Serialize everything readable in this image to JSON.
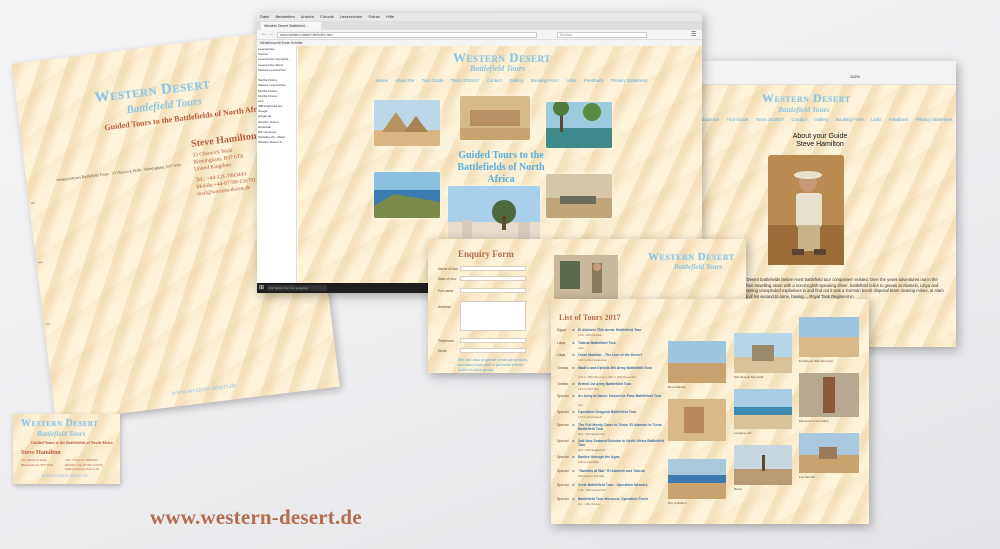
{
  "brand": {
    "title": "Western Desert",
    "subtitle": "Battlefield Tours",
    "tagline": "Guided Tours to the Battlefields of North Africa",
    "website": "www.western-desert.de"
  },
  "contact": {
    "name": "Steve Hamilton",
    "address_lines": [
      "33 Chiswick Walk",
      "Birmingham, B37 6TA",
      "United Kingdom"
    ],
    "tel": "Tel.: +44-121-7883443",
    "mobile": "Mobile:+44-07789-158701",
    "email": "mail@western-desert.de",
    "sender_line": "Western Desert Battlefield Tours · 33 Chiswick Walk · Birmingham, B37 6TA"
  },
  "browser1": {
    "menu": [
      "Datei",
      "Bearbeiten",
      "Ansicht",
      "Chronik",
      "Lesezeichen",
      "Extras",
      "Hilfe"
    ],
    "tab_title": "Western Desert Battlefield...",
    "url": "www.western-desert.de/index.htm",
    "search_placeholder": "Suchen",
    "bookmarks": "Meistbesucht  Erste Schritte",
    "sidebar_items": [
      "Lesezeichen",
      "Suchen",
      "Lesezeichen-Symbolle...",
      "Lesezeichen-Menü",
      "Weitere Lesezeichen",
      "",
      "Mozilla Firefox",
      "Weitere Lesezeichen",
      "Mozilla Firefox",
      "Mozilla Firefox",
      "web",
      "IMB Hightread Ed...",
      "Google",
      "google.de",
      "Western Desert...",
      "Reisewalt",
      "RR interpress",
      "Wüstebrecht - Mater...",
      "Western Desert S..."
    ],
    "nav": [
      "Home",
      "About Me",
      "Tour Guide",
      "Tours 2016/17",
      "Contact",
      "Gallery",
      "Booking Form",
      "Links",
      "Feedback",
      "Privacy Statement"
    ],
    "heading": "Guided Tours to the Battlefields of North Africa",
    "taskbar_search": "Zur Suche Text hier eingeben"
  },
  "browser2": {
    "zoom": "110%",
    "nav": [
      "About Me",
      "Tour Guide",
      "Tours 2016/17",
      "Contact",
      "Gallery",
      "Booking Form",
      "Links",
      "Feedback",
      "Privacy Statement"
    ],
    "about_title": "About your Guide",
    "about_name": "Steve Hamilton",
    "bio": "Western Desert battlefields before most battlefield tour companies' existed. Over the years adventures out in the desert, often travelling alone with a non-English-speaking driver. battlefield relics to graves at Alamein, Libya and Tunisia; seeing unexploded explosives in and find out it was a German bomb disposal team clearing mines, at Alam the shock of his second to none, having ... Royal Tank Regiment in"
  },
  "enquiry": {
    "title": "Enquiry Form",
    "labels": [
      "Name of tour",
      "Date of tour",
      "Full name",
      "Address",
      "Telephone",
      "Email"
    ],
    "note": "We can also organise small party tours, and also tours with a personal theme suited to your group.",
    "caption": "War Cemetery"
  },
  "tours": {
    "title": "List of Tours 2017",
    "items": [
      {
        "cat": "Egypt",
        "name": "El Alamein 75th Anniv. Battlefield Tour",
        "date": "17th - 28th October"
      },
      {
        "cat": "Libya",
        "name": "Tobruk Battlefield Tour",
        "date": "April"
      },
      {
        "cat": "Libya",
        "name": "Omar Mukhtar - The Lion of the Desert",
        "date": "12th to 21st September"
      },
      {
        "cat": "Tunisia",
        "name": "Wadi's and Djebels 8th Army Battlefield Tour",
        "date": "12th to 19th March and 19th to 26th November"
      },
      {
        "cat": "Tunisia",
        "name": "British 1st Army Battlefield Tour",
        "date": "14th to 23rd May"
      },
      {
        "cat": "Special",
        "name": "An Army at Dawn: Kasserine Pass Battlefield Tour",
        "date": "July"
      },
      {
        "cat": "Special",
        "name": "Operation Dragoon Battlefield Tour",
        "date": "14th to 21st August"
      },
      {
        "cat": "Special",
        "name": "The Full Monty Came to Tunis: El Alamein to Tunis Battlefield Tour",
        "date": "2nd - 14th September"
      },
      {
        "cat": "Special",
        "name": "2nd New Zealand Division in North Africa Battlefield Tour",
        "date": "2nd - 14th September"
      },
      {
        "cat": "Special",
        "name": "Battles through the Ages",
        "date": "14th to 21st May"
      },
      {
        "cat": "Special",
        "name": "\"Sandals at War\" El Alamein and Tobruk",
        "date": "19th April to 2nd May"
      },
      {
        "cat": "Special",
        "name": "Crete Battlefield Tour - Operation Mercury",
        "date": "17th - 25th September"
      },
      {
        "cat": "Special",
        "name": "Battlefield Tour Morocco: Operation Torch",
        "date": "3rd - 13th October"
      }
    ],
    "captions": [
      "Bir el Harmat",
      "Bay of Sollum",
      "Sidi Rezegh Memorial",
      "El Alamein War Memorial",
      "Longstop Hill",
      "Berda",
      "Memorial to the Fallen",
      "Wadi Akarit",
      "Fort Mechili"
    ]
  },
  "colors": {
    "brand_blue": "#8fc4e0",
    "accent_red": "#b75a3c",
    "url_brown": "#b26d4e",
    "sand": "#fdf3d9"
  }
}
